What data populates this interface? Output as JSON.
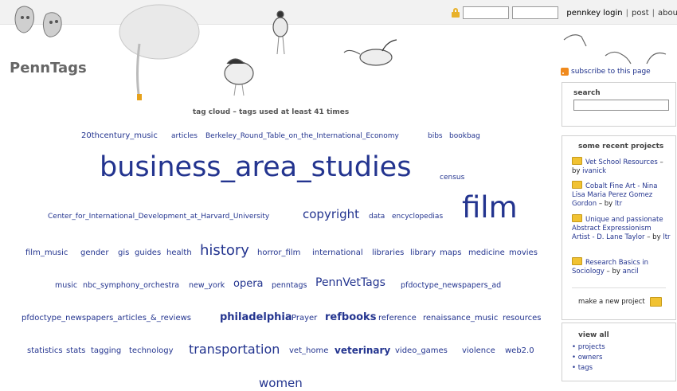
{
  "header": {
    "login_label": "pennkey login",
    "links": [
      "post",
      "abou"
    ],
    "separator": "|"
  },
  "logo": "PennTags",
  "cloud": {
    "title": "tag cloud – tags used at least 41 times",
    "tags": [
      "20thcentury_music",
      "articles",
      "Berkeley_Round_Table_on_the_International_Economy",
      "bibs",
      "bookbag",
      "business_area_studies",
      "census",
      "Center_for_International_Development_at_Harvard_University",
      "copyright",
      "data",
      "encyclopedias",
      "film",
      "film_music",
      "gender",
      "gis",
      "guides",
      "health",
      "history",
      "horror_film",
      "international",
      "libraries",
      "library",
      "maps",
      "medicine",
      "movies",
      "music",
      "nbc_symphony_orchestra",
      "new_york",
      "opera",
      "penntags",
      "PennVetTags",
      "pfdoctype_newspapers_ad",
      "pfdoctype_newspapers_articles_&_reviews",
      "philadelphia",
      "Prayer",
      "refbooks",
      "reference",
      "renaissance_music",
      "resources",
      "statistics",
      "stats",
      "tagging",
      "technology",
      "transportation",
      "vet_home",
      "veterinary",
      "video_games",
      "violence",
      "web2.0",
      "women"
    ]
  },
  "sidebar": {
    "subscribe": "subscribe to this page",
    "search_title": "search",
    "search_value": "",
    "projects_title": "some recent projects",
    "projects": [
      {
        "name": "Vet School Resources",
        "by_label": " – by ",
        "owner": "ivanick"
      },
      {
        "name": "Cobalt Fine Art - Nina Lisa Maria Perez Gomez Gordon",
        "by_label": " – by ",
        "owner": "ltr"
      },
      {
        "name": "Unique and passionate Abstract Expressionism Artist - D. Lane Taylor",
        "by_label": " – by ",
        "owner": "ltr"
      },
      {
        "name": "Research Basics in Sociology",
        "by_label": " – by ",
        "owner": "ancil"
      }
    ],
    "make_project": "make a new project",
    "view_title": "view all",
    "view_items": [
      "projects",
      "owners",
      "tags"
    ]
  },
  "colors": {
    "tag": "#23348f",
    "accent": "#f1c232"
  }
}
